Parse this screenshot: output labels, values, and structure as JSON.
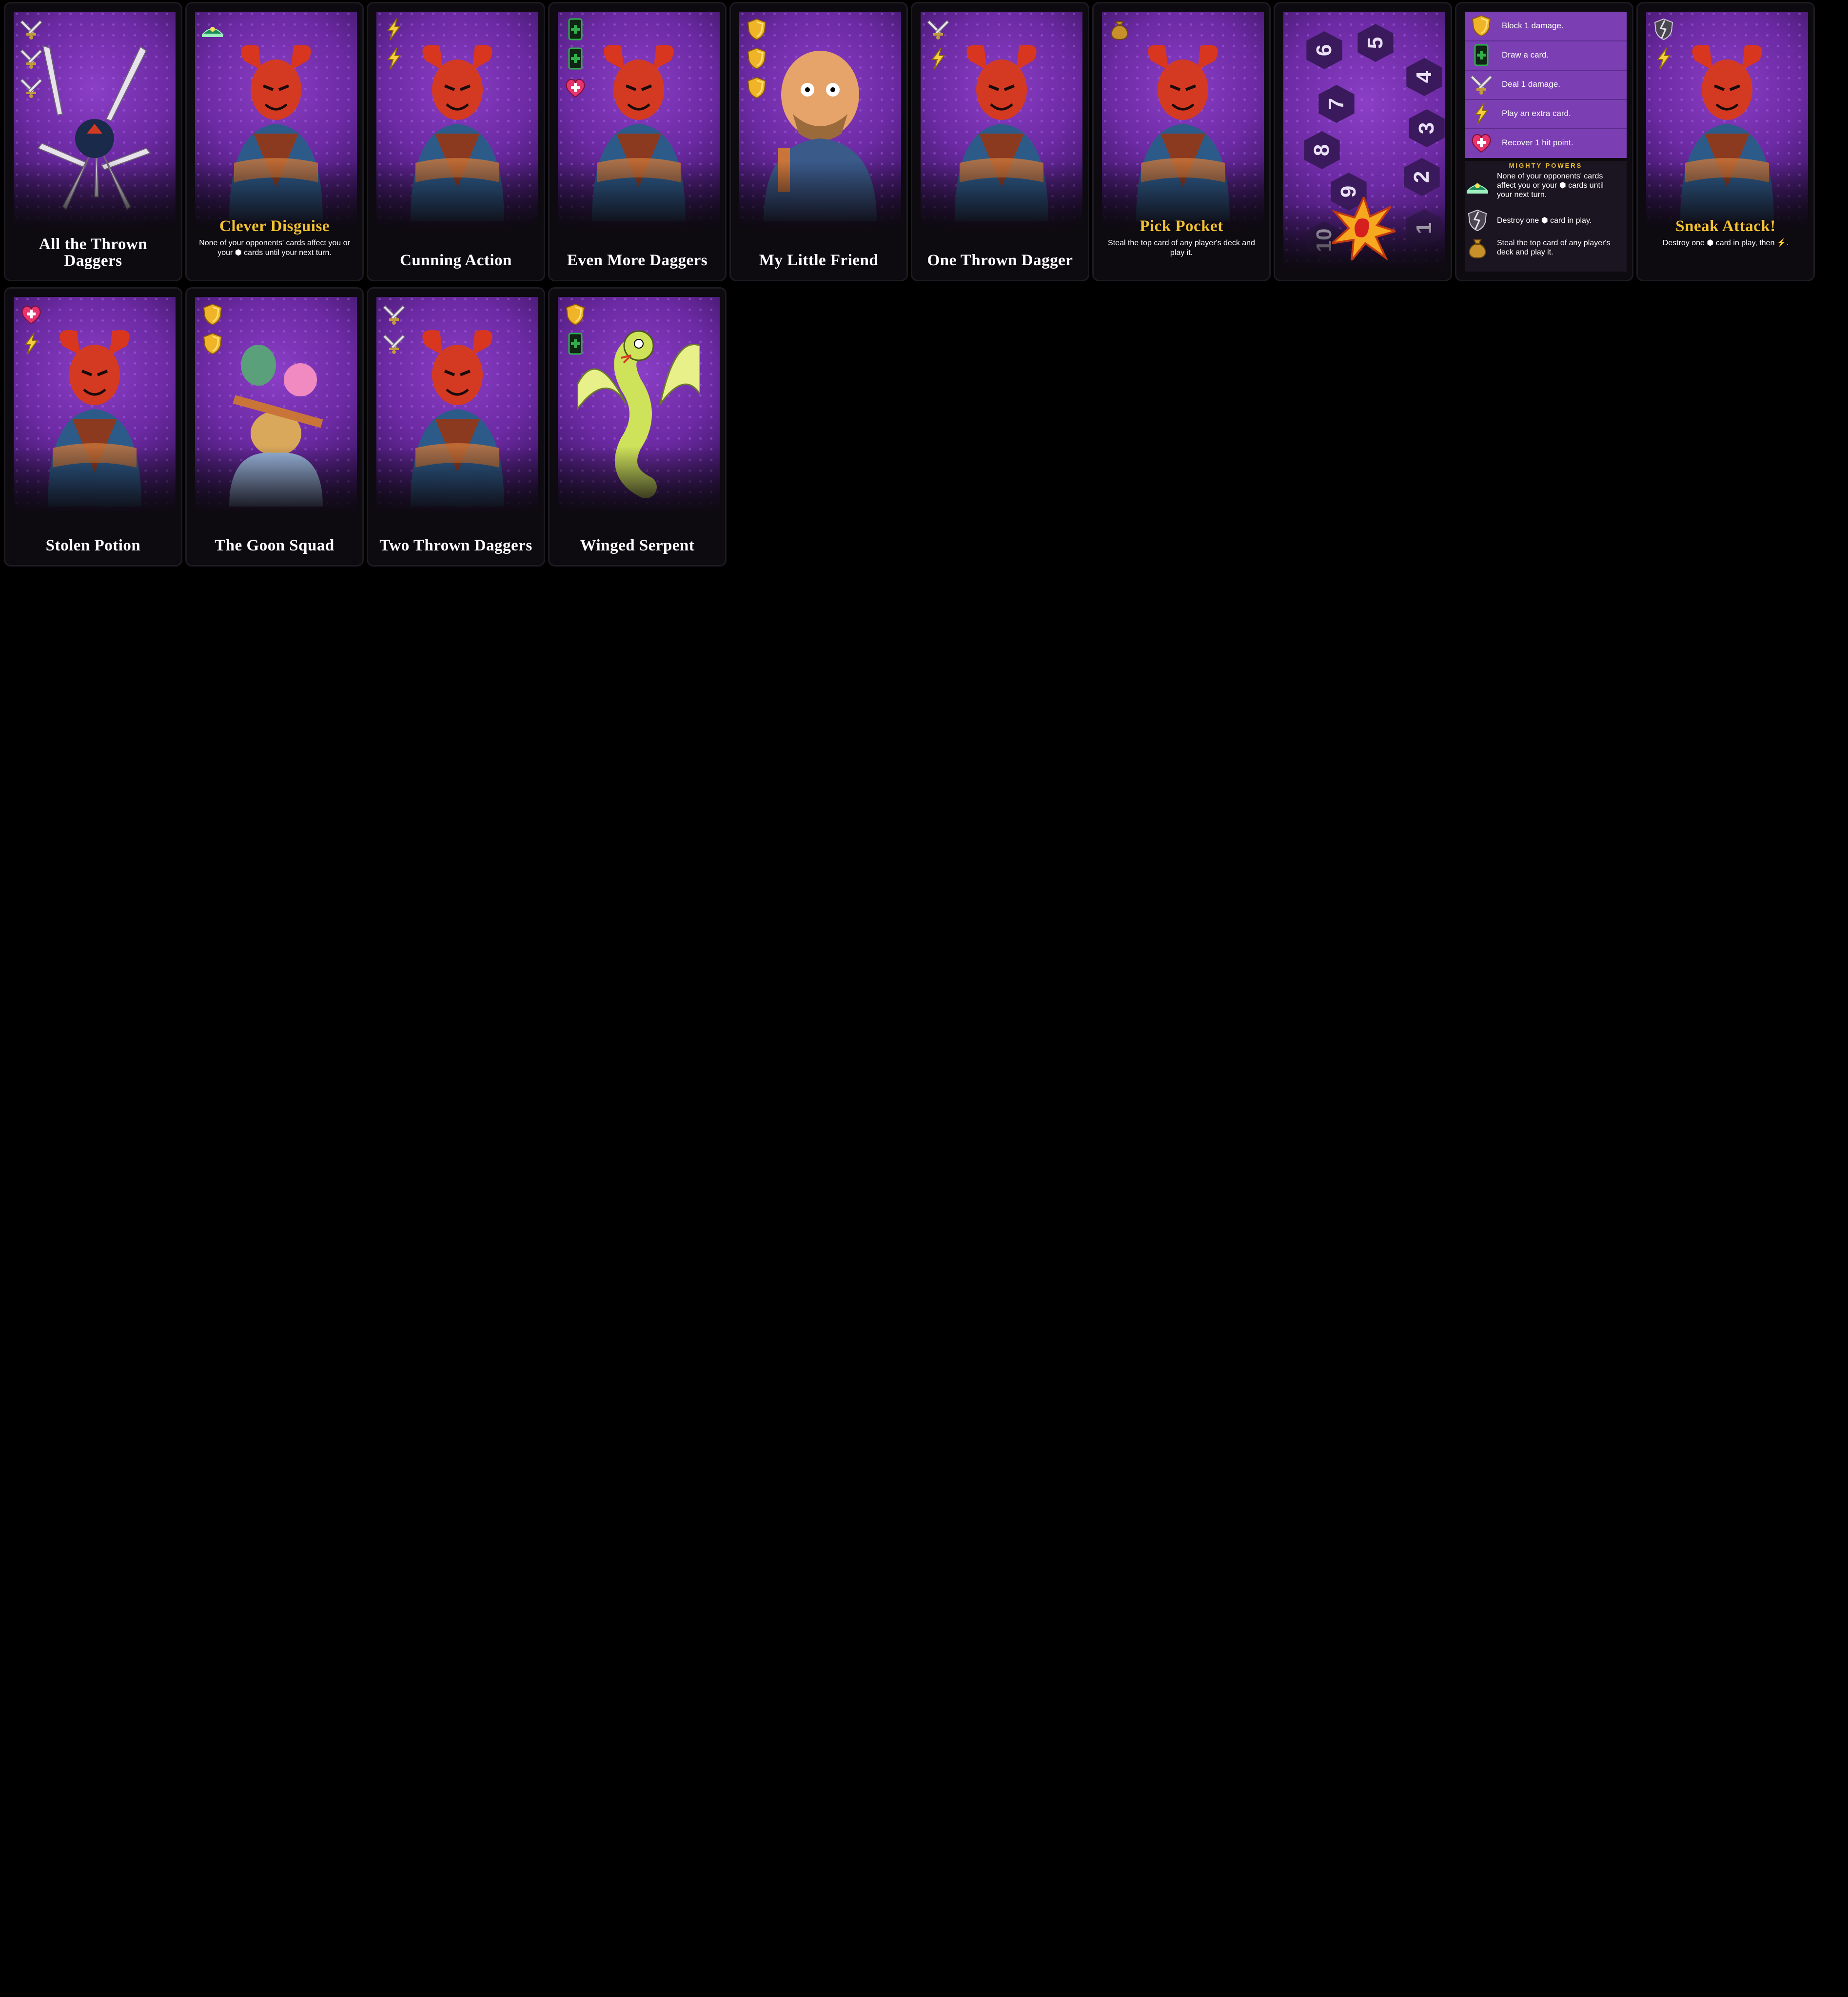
{
  "colors": {
    "card_purple": "#6c2aa3",
    "title_gold": "#f1c232",
    "title_white": "#ffffff",
    "shield_gold": "#f0b428",
    "heart_pink": "#e8336f",
    "draw_green": "#2fae4a"
  },
  "cards": [
    {
      "title": "All the Thrown Daggers",
      "title_color": "white",
      "icons": [
        "dagger-attack-icon",
        "dagger-attack-icon",
        "dagger-attack-icon"
      ],
      "description": "",
      "figure": "daggers"
    },
    {
      "title": "Clever Disguise",
      "title_color": "gold",
      "icons": [
        "disguise-mighty-icon"
      ],
      "description": "None of your opponents' cards affect you or your ⬢ cards until your next turn.",
      "figure": "devil"
    },
    {
      "title": "Cunning Action",
      "title_color": "white",
      "icons": [
        "lightning-icon",
        "lightning-icon"
      ],
      "description": "",
      "figure": "devil"
    },
    {
      "title": "Even More Daggers",
      "title_color": "white",
      "icons": [
        "draw-card-icon",
        "draw-card-icon",
        "heart-icon"
      ],
      "description": "",
      "figure": "devil"
    },
    {
      "title": "My Little Friend",
      "title_color": "white",
      "icons": [
        "shield-icon",
        "shield-icon",
        "shield-icon"
      ],
      "description": "",
      "figure": "brute"
    },
    {
      "title": "One Thrown Dagger",
      "title_color": "white",
      "icons": [
        "dagger-attack-icon",
        "lightning-icon"
      ],
      "description": "",
      "figure": "devil"
    },
    {
      "title": "Pick Pocket",
      "title_color": "gold",
      "icons": [
        "coin-bag-icon"
      ],
      "description": "Steal the top card of any player's deck and play it.",
      "figure": "devil"
    },
    {
      "title": "",
      "title_color": "white",
      "icons": [],
      "description": "",
      "figure": "counter"
    },
    {
      "title": "",
      "title_color": "white",
      "icons": [],
      "description": "",
      "figure": "reference"
    },
    {
      "title": "Sneak Attack!",
      "title_color": "gold",
      "icons": [
        "shield-break-icon",
        "lightning-icon"
      ],
      "description": "Destroy one ⬢ card in play, then ⚡.",
      "figure": "devil"
    },
    {
      "title": "Stolen Potion",
      "title_color": "white",
      "icons": [
        "heart-icon",
        "lightning-icon"
      ],
      "description": "",
      "figure": "devil"
    },
    {
      "title": "The Goon Squad",
      "title_color": "white",
      "icons": [
        "shield-icon",
        "shield-icon"
      ],
      "description": "",
      "figure": "goons"
    },
    {
      "title": "Two Thrown Daggers",
      "title_color": "white",
      "icons": [
        "dagger-attack-icon",
        "dagger-attack-icon"
      ],
      "description": "",
      "figure": "devil"
    },
    {
      "title": "Winged Serpent",
      "title_color": "white",
      "icons": [
        "shield-icon",
        "draw-card-icon"
      ],
      "description": "",
      "figure": "serpent"
    }
  ],
  "counter": {
    "numbers": [
      "6",
      "5",
      "4",
      "7",
      "3",
      "8",
      "2",
      "9",
      "1",
      "10"
    ]
  },
  "reference": {
    "rows": [
      {
        "icon": "shield-icon",
        "text": "Block 1 damage."
      },
      {
        "icon": "draw-card-icon",
        "text": "Draw a card."
      },
      {
        "icon": "dagger-attack-icon",
        "text": "Deal 1 damage."
      },
      {
        "icon": "lightning-icon",
        "text": "Play an extra card."
      },
      {
        "icon": "heart-icon",
        "text": "Recover 1 hit point."
      }
    ],
    "mighty_heading": "MIGHTY POWERS",
    "mighty_rows": [
      {
        "icon": "disguise-mighty-icon",
        "text": "None of your opponents' cards affect you or your ⬢ cards until your next turn."
      },
      {
        "icon": "shield-break-icon",
        "text": "Destroy one ⬢ card in play."
      },
      {
        "icon": "coin-bag-icon",
        "text": "Steal the top card of any player's deck and play it."
      }
    ]
  }
}
